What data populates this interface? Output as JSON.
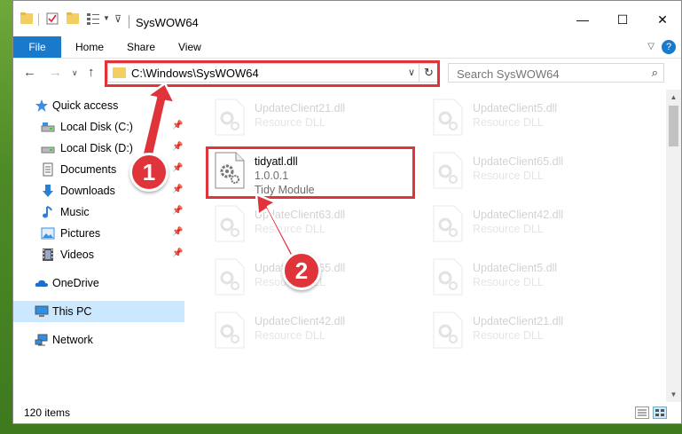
{
  "window": {
    "title": "SysWOW64",
    "minimize": "—",
    "maximize": "☐",
    "close": "✕"
  },
  "ribbon": {
    "tabs": [
      "File",
      "Home",
      "Share",
      "View"
    ],
    "help": "?"
  },
  "address": {
    "path": "C:\\Windows\\SysWOW64",
    "dropdown": "∨",
    "refresh": "↻"
  },
  "search": {
    "placeholder": "Search SysWOW64"
  },
  "sidebar": {
    "items": [
      {
        "label": "Quick access",
        "icon": "star-icon"
      },
      {
        "label": "Local Disk (C:)",
        "icon": "drive-icon",
        "pinned": true
      },
      {
        "label": "Local Disk (D:)",
        "icon": "drive-icon",
        "pinned": true
      },
      {
        "label": "Documents",
        "icon": "documents-icon",
        "pinned": true
      },
      {
        "label": "Downloads",
        "icon": "download-icon",
        "pinned": true
      },
      {
        "label": "Music",
        "icon": "music-icon",
        "pinned": true
      },
      {
        "label": "Pictures",
        "icon": "pictures-icon",
        "pinned": true
      },
      {
        "label": "Videos",
        "icon": "videos-icon",
        "pinned": true
      },
      {
        "label": "OneDrive",
        "icon": "cloud-icon"
      },
      {
        "label": "This PC",
        "icon": "computer-icon",
        "selected": true
      },
      {
        "label": "Network",
        "icon": "network-icon"
      }
    ]
  },
  "files": {
    "highlighted": {
      "name": "tidyatl.dll",
      "version": "1.0.0.1",
      "description": "Tidy Module"
    },
    "ghosts": [
      {
        "name": "UpdateClient21.dll",
        "type": "Resource DLL"
      },
      {
        "name": "UpdateClient5.dll",
        "type": "Resource DLL"
      },
      {
        "name": "UpdateClient65.dll",
        "type": "Resource DLL"
      },
      {
        "name": "UpdateClient63.dll",
        "type": "Resource DLL"
      },
      {
        "name": "UpdateClient42.dll",
        "type": "Resource DLL"
      },
      {
        "name": "UpdateClient65.dll",
        "type": "Resource DLL"
      },
      {
        "name": "UpdateClient5.dll",
        "type": "Resource DLL"
      },
      {
        "name": "UpdateClient42.dll",
        "type": "Resource DLL"
      },
      {
        "name": "UpdateClient21.dll",
        "type": "Resource DLL"
      }
    ]
  },
  "status": {
    "count": "120 items"
  },
  "annotations": {
    "step1": "1",
    "step2": "2",
    "color": "#e0343b"
  },
  "colors": {
    "accent": "#1979ca",
    "selected": "#cce8ff"
  }
}
